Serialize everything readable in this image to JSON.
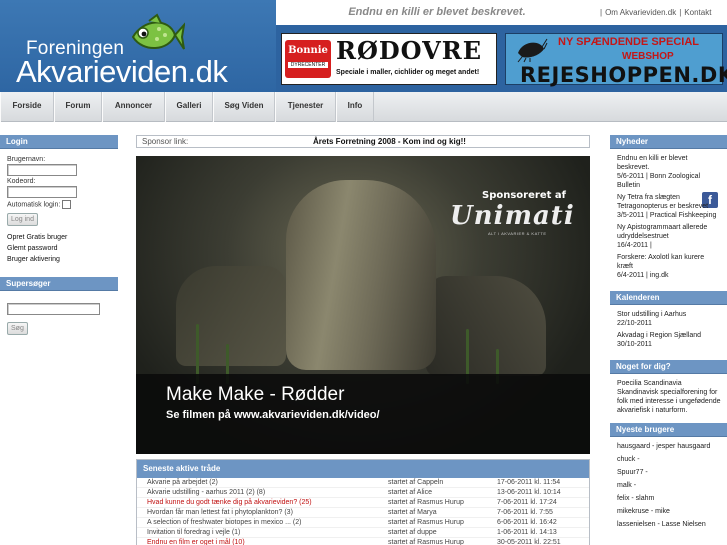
{
  "header": {
    "logo_small": "Foreningen",
    "logo_big": "Akvarieviden.dk",
    "slogan": "Endnu en killi er blevet beskrevet.",
    "top_links": [
      "Om Akvarieviden.dk",
      "Kontakt"
    ]
  },
  "ads": {
    "rodovre": {
      "badge_top": "Bonnie",
      "badge_bottom": "DYRECENTER",
      "title": "RØDOVRE",
      "subtitle": "Speciale i maller, cichlider og meget andet!"
    },
    "rejeshoppen": {
      "line1": "NY SPÆNDENDE SPECIAL",
      "line2": "WEBSHOP",
      "line3": "REJESHOPPEN.DK"
    }
  },
  "nav": {
    "items": [
      {
        "label": "Forside"
      },
      {
        "label": "Forum"
      },
      {
        "label": "Annoncer"
      },
      {
        "label": "Galleri"
      },
      {
        "label": "Søg Viden"
      },
      {
        "label": "Tjenester"
      },
      {
        "label": "Info"
      }
    ],
    "facebook_icon": "f"
  },
  "login": {
    "title": "Login",
    "username_label": "Brugernavn:",
    "password_label": "Kodeord:",
    "auto_login_label": "Automatisk login:",
    "login_button": "Log ind",
    "links": [
      "Opret Gratis bruger",
      "Glemt password",
      "Bruger aktivering"
    ]
  },
  "search": {
    "title": "Supersøger",
    "button": "Søg"
  },
  "sponsor": {
    "label": "Sponsor link:",
    "text": "Årets Forretning 2008 - Kom ind og kig!!"
  },
  "video": {
    "sponsored": "Sponsoreret af",
    "brand": "Unimati",
    "brand_sub": "ALT I AKVARIER & KATTE",
    "title": "Make Make - Rødder",
    "subtitle": "Se filmen på www.akvarieviden.dk/video/"
  },
  "threads": {
    "title": "Seneste aktive tråde",
    "rows": [
      {
        "title": "Akvarie på arbejdet (2)",
        "starter": "startet af Cappeln",
        "date": "17-06-2011 kl. 11:54",
        "red": false
      },
      {
        "title": "Akvarie udstilling - aarhus 2011 (2) (8)",
        "starter": "startet af Alice",
        "date": "13-06-2011 kl. 10:14",
        "red": false
      },
      {
        "title": "Hvad kunne du godt tænke dig på akvarieviden? (25)",
        "starter": "startet af Rasmus Hurup",
        "date": "7-06-2011 kl. 17:24",
        "red": true
      },
      {
        "title": "Hvordan får man lettest fat i phytoplankton? (3)",
        "starter": "startet af Marya",
        "date": "7-06-2011 kl. 7:55",
        "red": false
      },
      {
        "title": "A selection of freshwater biotopes in mexico ... (2)",
        "starter": "startet af Rasmus Hurup",
        "date": "6-06-2011 kl. 16:42",
        "red": false
      },
      {
        "title": "Invitation til foredrag i vejle (1)",
        "starter": "startet af duppe",
        "date": "1-06-2011 kl. 14:13",
        "red": false
      },
      {
        "title": "Endnu en film er oget i mål (10)",
        "starter": "startet af Rasmus Hurup",
        "date": "30-05-2011 kl. 22:51",
        "red": true
      }
    ]
  },
  "news": {
    "title": "Nyheder",
    "items": [
      "Endnu en killi er blevet beskrevet.",
      "5/6-2011 | Bonn Zoological Bulletin",
      "Ny Tetra fra slægten Tetragonopterus er beskrevet",
      "3/5-2011 | Practical Fishkeeping",
      "Ny Apistogrammaart allerede udryddelsestruet",
      "16/4-2011 |",
      "Forskere: Axolotl kan kurere kræft",
      "6/4-2011 | ing.dk"
    ]
  },
  "calendar": {
    "title": "Kalenderen",
    "items": [
      "Stor udstilling i Aarhus",
      "22/10-2011",
      "Akvadag i Region Sjælland",
      "30/10-2011"
    ]
  },
  "something": {
    "title": "Noget for dig?",
    "text": "Poecilia Scandinavia Skandinavisk specialforening for folk med interesse i ungefødende akvariefisk i naturform."
  },
  "users": {
    "title": "Nyeste brugere",
    "items": [
      "hausgaard - jesper hausgaard",
      "chuck -",
      "Spuur77 -",
      "malk -",
      "felix - slahm",
      "mikekruse - mike",
      "lassenielsen - Lasse Nielsen"
    ]
  }
}
